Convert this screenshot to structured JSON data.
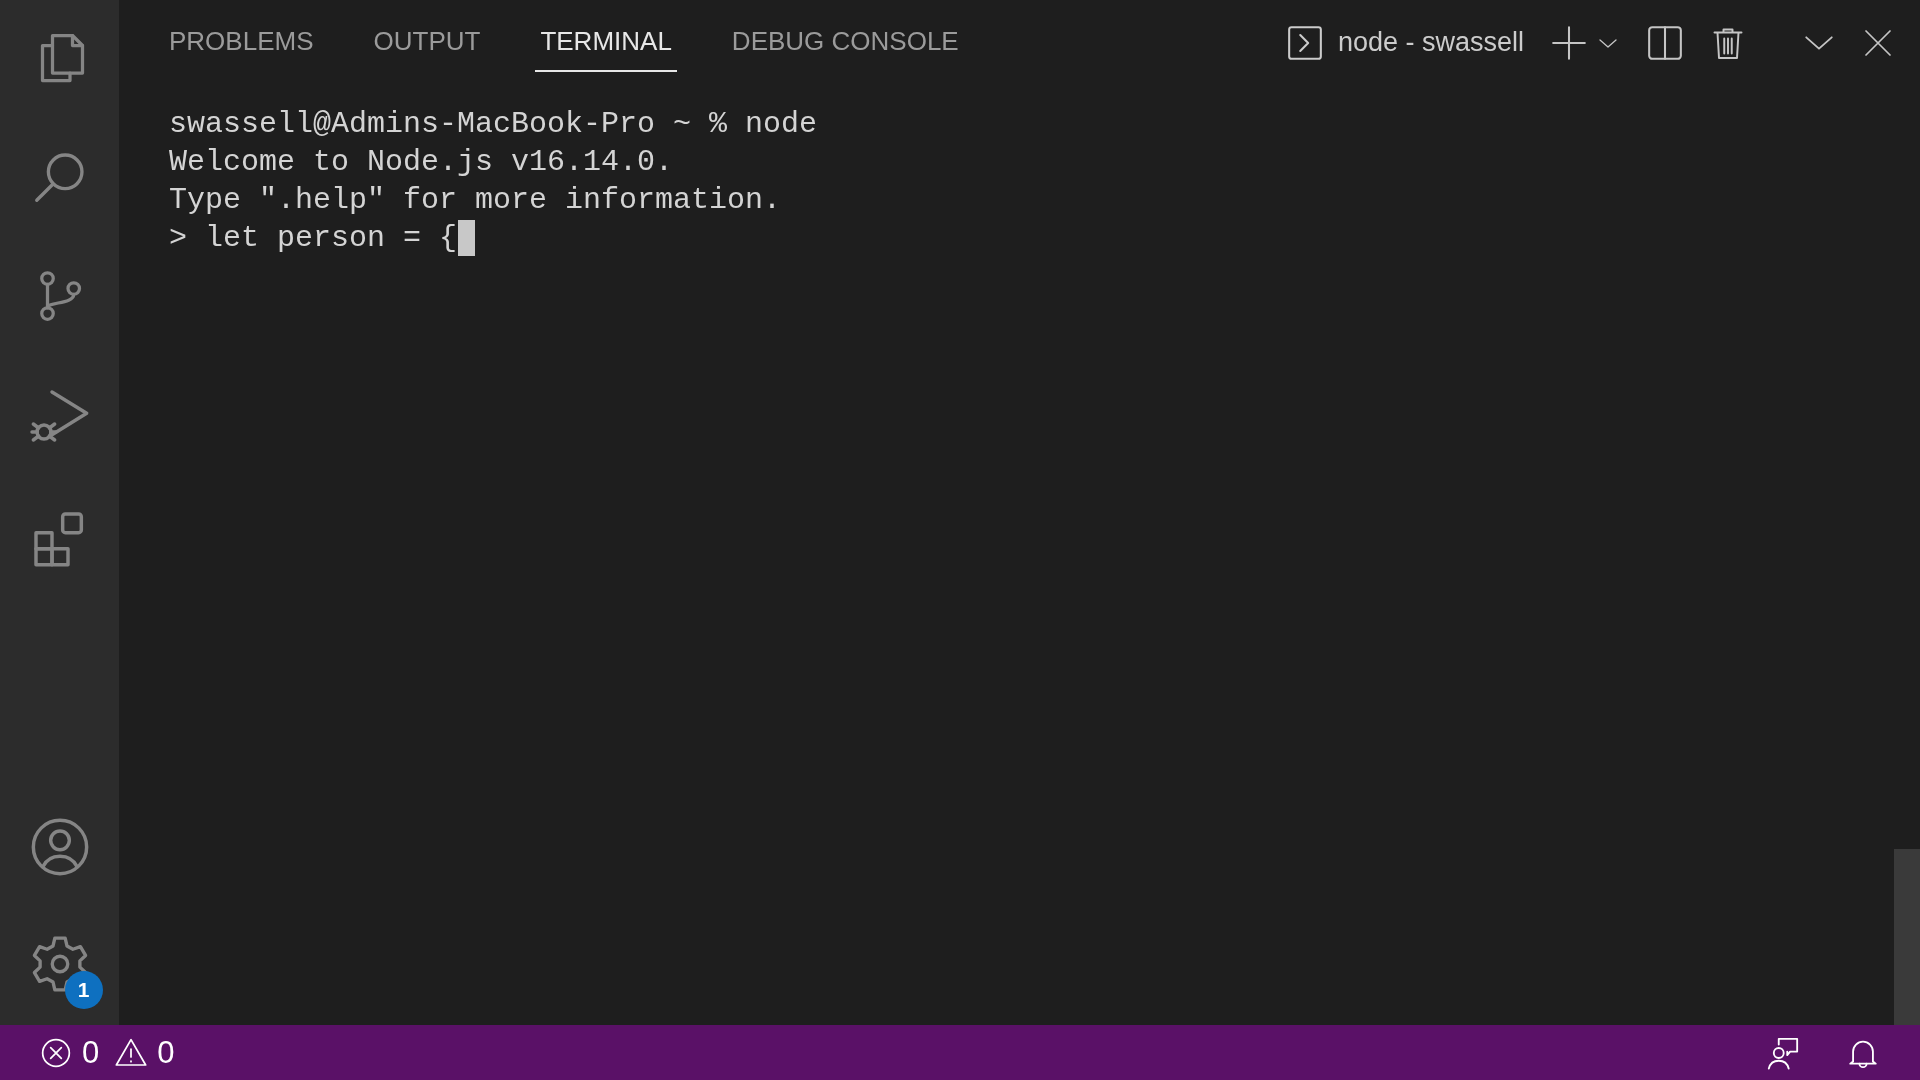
{
  "activity_bar": {
    "settings_badge": "1"
  },
  "panel": {
    "tabs": [
      {
        "label": "PROBLEMS",
        "selected": false
      },
      {
        "label": "OUTPUT",
        "selected": false
      },
      {
        "label": "TERMINAL",
        "selected": true
      },
      {
        "label": "DEBUG CONSOLE",
        "selected": false
      }
    ],
    "terminal_name": "node - swassell"
  },
  "terminal": {
    "lines": [
      "swassell@Admins-MacBook-Pro ~ % node",
      "Welcome to Node.js v16.14.0.",
      "Type \".help\" for more information.",
      "> let person = {"
    ]
  },
  "status_bar": {
    "errors": "0",
    "warnings": "0"
  }
}
